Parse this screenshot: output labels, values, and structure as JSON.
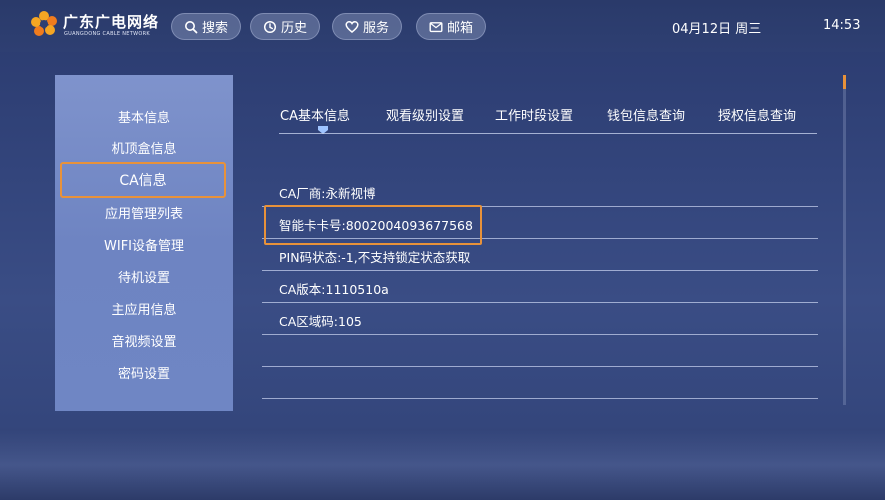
{
  "header": {
    "logo_cn": "广东广电网络",
    "logo_en": "GUANGDONG CABLE NETWORK",
    "nav": [
      {
        "label": "搜索",
        "icon": "search-icon"
      },
      {
        "label": "历史",
        "icon": "clock-icon"
      },
      {
        "label": "服务",
        "icon": "heart-icon"
      },
      {
        "label": "邮箱",
        "icon": "mail-icon"
      }
    ],
    "date": "04月12日 周三",
    "time": "14:53"
  },
  "sidebar": {
    "items": [
      {
        "label": "基本信息"
      },
      {
        "label": "机顶盒信息"
      },
      {
        "label": "CA信息",
        "selected": true
      },
      {
        "label": "应用管理列表"
      },
      {
        "label": "WIFI设备管理"
      },
      {
        "label": "待机设置"
      },
      {
        "label": "主应用信息"
      },
      {
        "label": "音视频设置"
      },
      {
        "label": "密码设置"
      }
    ]
  },
  "main": {
    "tabs": [
      {
        "label": "CA基本信息",
        "active": true
      },
      {
        "label": "观看级别设置"
      },
      {
        "label": "工作时段设置"
      },
      {
        "label": "钱包信息查询"
      },
      {
        "label": "授权信息查询"
      }
    ],
    "rows": [
      "CA厂商:永新视博",
      "智能卡卡号:8002004093677568",
      "PIN码状态:-1,不支持锁定状态获取",
      "CA版本:1110510a",
      "CA区域码:105",
      "",
      ""
    ]
  },
  "colors": {
    "highlight": "#e8923a",
    "sidebar_bg": "#7388c4",
    "background": "#34467c"
  }
}
